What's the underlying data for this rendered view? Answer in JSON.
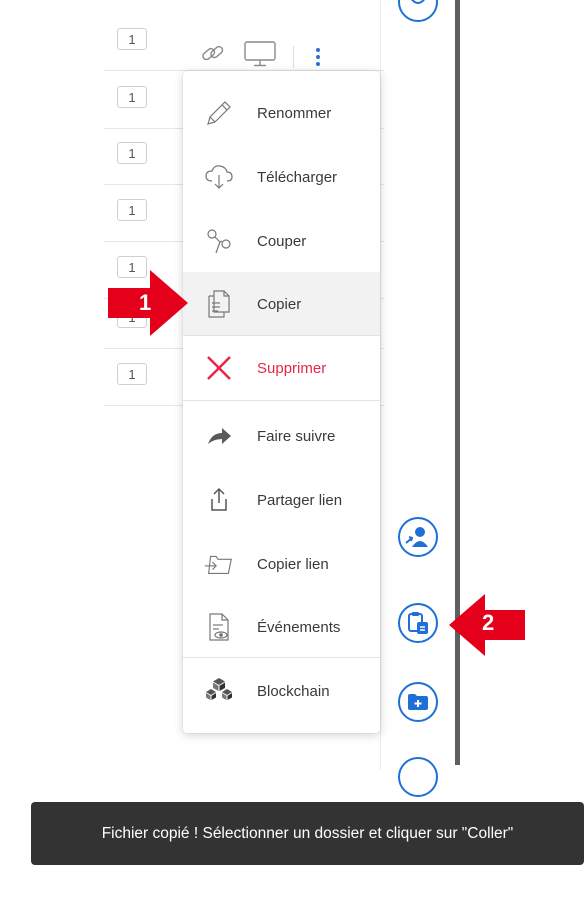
{
  "file_rows": [
    {
      "count": "1"
    },
    {
      "count": "1"
    },
    {
      "count": "1"
    },
    {
      "count": "1"
    },
    {
      "count": "1"
    },
    {
      "count": "1"
    },
    {
      "count": "1"
    }
  ],
  "context_menu": {
    "items": [
      {
        "label": "Renommer",
        "icon": "pencil-icon"
      },
      {
        "label": "Télécharger",
        "icon": "cloud-download-icon"
      },
      {
        "label": "Couper",
        "icon": "scissors-icon"
      },
      {
        "label": "Copier",
        "icon": "copy-icon"
      },
      {
        "label": "Supprimer",
        "icon": "close-icon"
      },
      {
        "label": "Faire suivre",
        "icon": "forward-icon"
      },
      {
        "label": "Partager lien",
        "icon": "share-icon"
      },
      {
        "label": "Copier lien",
        "icon": "folder-link-icon"
      },
      {
        "label": "Événements",
        "icon": "document-eye-icon"
      },
      {
        "label": "Blockchain",
        "icon": "blockchain-icon"
      }
    ]
  },
  "annotations": {
    "step1": "1",
    "step2": "2"
  },
  "toast": {
    "message": "Fichier copié ! Sélectionner un dossier et cliquer sur \"Coller\""
  },
  "colors": {
    "accent": "#1f6fd9",
    "danger": "#e8264a",
    "arrow": "#e4001b",
    "toast_bg": "#333333"
  }
}
